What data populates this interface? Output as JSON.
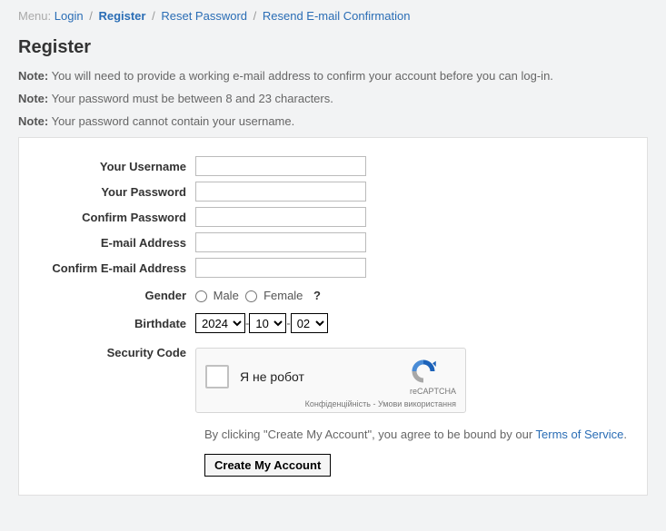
{
  "menu": {
    "label": "Menu:",
    "items": [
      "Login",
      "Register",
      "Reset Password",
      "Resend E-mail Confirmation"
    ],
    "active_index": 1
  },
  "page_title": "Register",
  "notes": [
    {
      "bold": "Note:",
      "text": " You will need to provide a working e-mail address to confirm your account before you can log-in."
    },
    {
      "bold": "Note:",
      "text": " Your password must be between 8 and 23 characters."
    },
    {
      "bold": "Note:",
      "text": " Your password cannot contain your username."
    }
  ],
  "form": {
    "username": {
      "label": "Your Username",
      "value": ""
    },
    "password": {
      "label": "Your Password",
      "value": ""
    },
    "confirm_password": {
      "label": "Confirm Password",
      "value": ""
    },
    "email": {
      "label": "E-mail Address",
      "value": ""
    },
    "confirm_email": {
      "label": "Confirm E-mail Address",
      "value": ""
    },
    "gender": {
      "label": "Gender",
      "male": "Male",
      "female": "Female",
      "help": "?"
    },
    "birthdate": {
      "label": "Birthdate",
      "year": "2024",
      "month": "10",
      "day": "02"
    },
    "security_code": {
      "label": "Security Code"
    },
    "captcha": {
      "checkbox_label": "Я не робот",
      "brand": "reCAPTCHA",
      "footer": "Конфіденційність - Умови використання"
    },
    "tos": {
      "prefix": "By clicking \"Create My Account\", you agree to be bound by our ",
      "link": "Terms of Service",
      "suffix": "."
    },
    "submit": "Create My Account"
  }
}
